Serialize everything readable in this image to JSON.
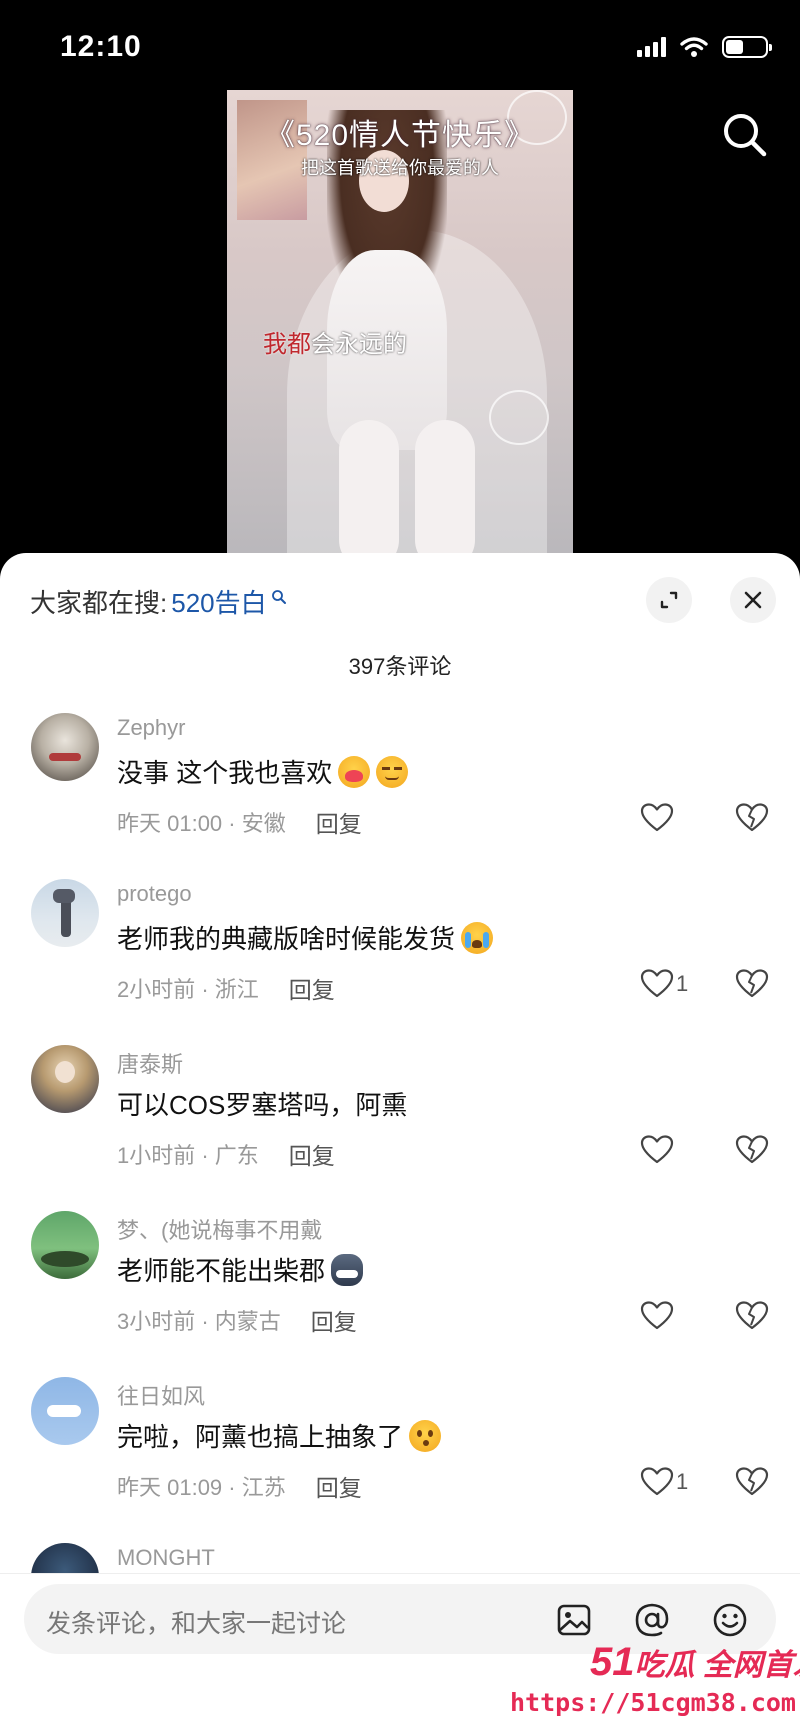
{
  "status_bar": {
    "time": "12:10"
  },
  "video": {
    "title": "《520情人节快乐》",
    "subtitle": "把这首歌送给你最爱的人",
    "lyric_red": "我都",
    "lyric_white": "会永远的"
  },
  "sheet": {
    "hot_search_label": "大家都在搜:",
    "hot_search_keyword": "520告白",
    "comment_count": "397条评论"
  },
  "comments": [
    {
      "username": "Zephyr",
      "text": "没事 这个我也喜欢",
      "time_location": "昨天 01:00 · 安徽",
      "reply": "回复",
      "likes": ""
    },
    {
      "username": "protego",
      "text": "老师我的典藏版啥时候能发货",
      "time_location": "2小时前 · 浙江",
      "reply": "回复",
      "likes": "1"
    },
    {
      "username": "唐泰斯",
      "text": "可以COS罗塞塔吗，阿熏",
      "time_location": "1小时前 · 广东",
      "reply": "回复",
      "likes": ""
    },
    {
      "username": "梦、(她说梅事不用戴",
      "text": "老师能不能出柴郡",
      "time_location": "3小时前 · 内蒙古",
      "reply": "回复",
      "likes": ""
    },
    {
      "username": "往日如风",
      "text": "完啦，阿薰也搞上抽象了",
      "time_location": "昨天 01:09 · 江苏",
      "reply": "回复",
      "likes": "1"
    },
    {
      "username": "MONGHT",
      "text": "",
      "time_location": "",
      "reply": "",
      "likes": ""
    }
  ],
  "input_bar": {
    "placeholder": "发条评论，和大家一起讨论"
  },
  "watermark": {
    "brand_num": "51",
    "brand_text": "吃瓜 全网首发",
    "url": "https://51cgm38.com"
  },
  "colors": {
    "keyword": "#1d57a8",
    "watermark": "#e52a55",
    "lyric_red": "#c0282e"
  }
}
